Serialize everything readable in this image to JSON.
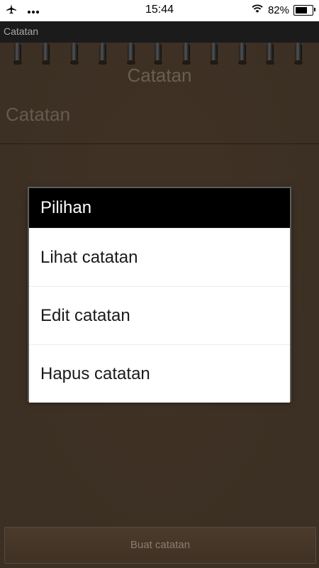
{
  "status_bar": {
    "time": "15:44",
    "battery": "82%",
    "battery_level": 0.82,
    "icons": [
      "airplane-icon",
      "more-icon",
      "wifi-icon",
      "battery-icon"
    ]
  },
  "app": {
    "title": "Catatan"
  },
  "notebook": {
    "title": "Catatan",
    "label": "Catatan"
  },
  "dialog": {
    "title": "Pilihan",
    "items": [
      {
        "label": "Lihat catatan"
      },
      {
        "label": "Edit catatan"
      },
      {
        "label": "Hapus catatan"
      }
    ]
  },
  "bottom": {
    "button_label": "Buat catatan"
  },
  "colors": {
    "background": "#4a3a2b",
    "dialog_header": "#000000",
    "dialog_body": "#ffffff"
  }
}
